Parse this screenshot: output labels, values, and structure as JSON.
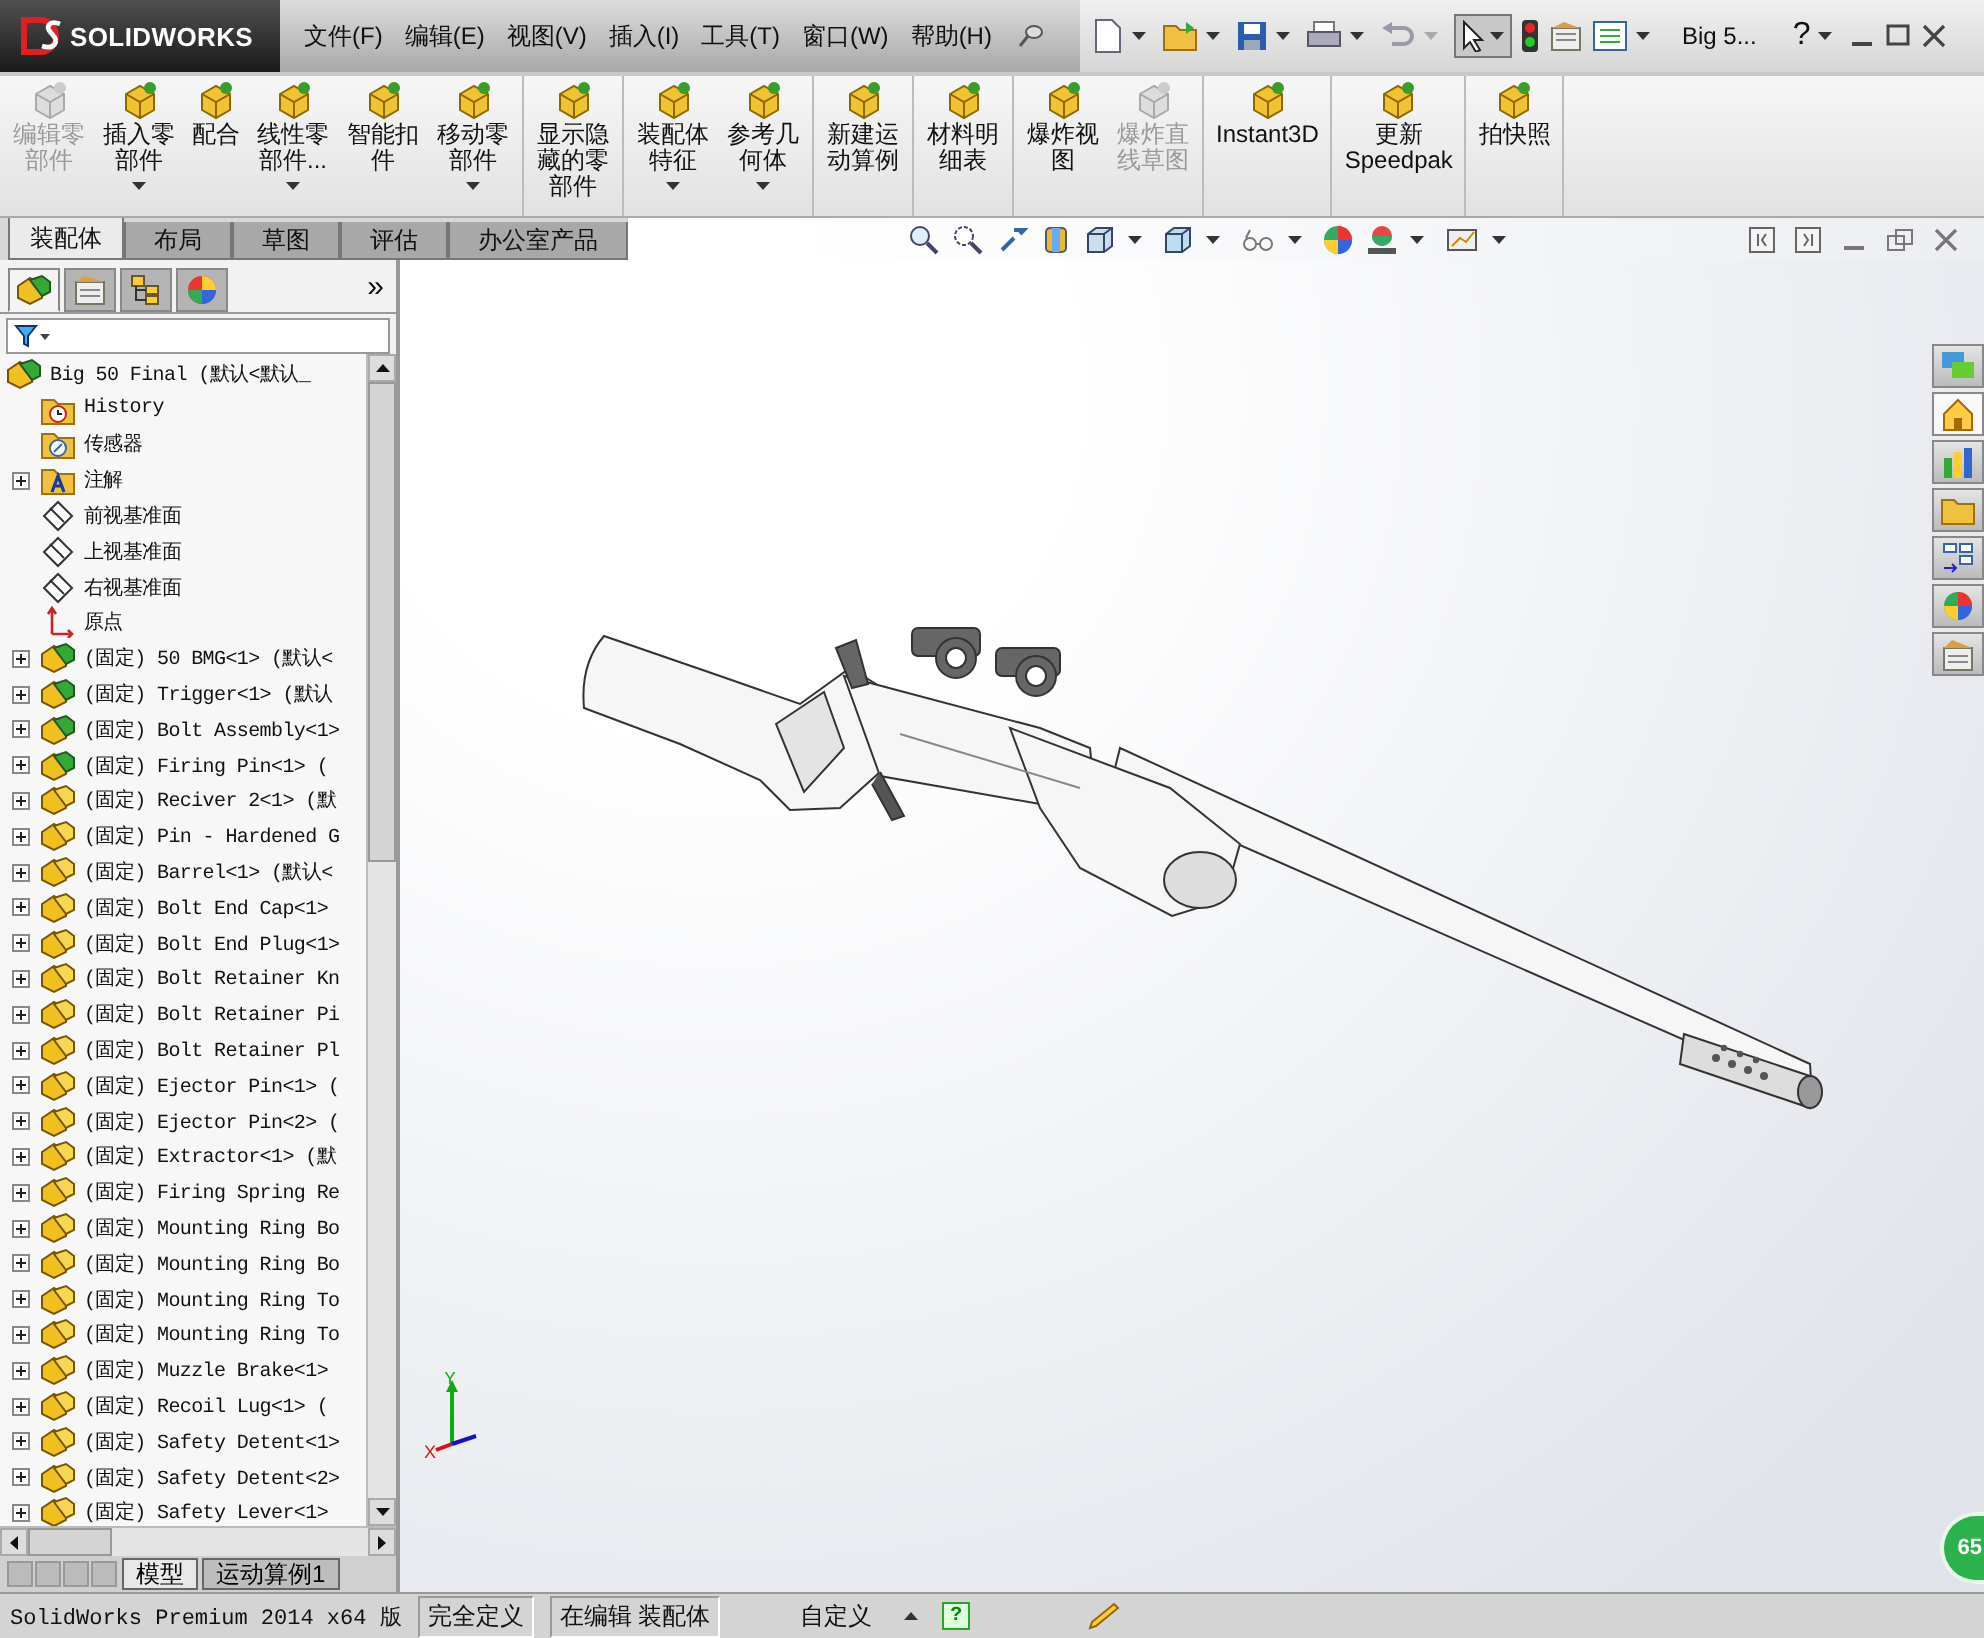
{
  "title_bar": {
    "logo": "SOLIDWORKS",
    "menus": [
      "文件(F)",
      "编辑(E)",
      "视图(V)",
      "插入(I)",
      "工具(T)",
      "窗口(W)",
      "帮助(H)"
    ],
    "document": "Big 5...",
    "help": "?"
  },
  "ribbon": {
    "groups": [
      {
        "buttons": [
          {
            "label": "编辑零部件",
            "disabled": true,
            "dropdown": false
          },
          {
            "label": "插入零部件",
            "disabled": false,
            "dropdown": true
          },
          {
            "label": "配合",
            "disabled": false,
            "dropdown": false
          },
          {
            "label": "线性零部件...",
            "disabled": false,
            "dropdown": true
          },
          {
            "label": "智能扣件",
            "disabled": false,
            "dropdown": false
          },
          {
            "label": "移动零部件",
            "disabled": false,
            "dropdown": true
          }
        ]
      },
      {
        "buttons": [
          {
            "label": "显示隐藏的零部件",
            "disabled": false,
            "dropdown": false
          }
        ]
      },
      {
        "buttons": [
          {
            "label": "装配体特征",
            "disabled": false,
            "dropdown": true
          },
          {
            "label": "参考几何体",
            "disabled": false,
            "dropdown": true
          }
        ]
      },
      {
        "buttons": [
          {
            "label": "新建运动算例",
            "disabled": false,
            "dropdown": false
          }
        ]
      },
      {
        "buttons": [
          {
            "label": "材料明细表",
            "disabled": false,
            "dropdown": false
          }
        ]
      },
      {
        "buttons": [
          {
            "label": "爆炸视图",
            "disabled": false,
            "dropdown": false
          },
          {
            "label": "爆炸直线草图",
            "disabled": true,
            "dropdown": false
          }
        ]
      },
      {
        "buttons": [
          {
            "label": "Instant3D",
            "disabled": false,
            "dropdown": false
          }
        ]
      },
      {
        "buttons": [
          {
            "label": "更新Speedpak",
            "disabled": false,
            "dropdown": false
          }
        ]
      },
      {
        "buttons": [
          {
            "label": "拍快照",
            "disabled": false,
            "dropdown": false
          }
        ]
      }
    ]
  },
  "command_tabs": [
    {
      "label": "装配体",
      "selected": true
    },
    {
      "label": "布局",
      "selected": false
    },
    {
      "label": "草图",
      "selected": false
    },
    {
      "label": "评估",
      "selected": false
    },
    {
      "label": "办公室产品",
      "selected": false
    }
  ],
  "panel": {
    "tabs": [
      {
        "kind": "tree",
        "selected": true
      },
      {
        "kind": "properties",
        "selected": false
      },
      {
        "kind": "configurations",
        "selected": false
      },
      {
        "kind": "display",
        "selected": false
      }
    ],
    "more": "»",
    "tree": {
      "label": "Big 50 Final  (默认<默认_",
      "kind": "assembly",
      "children": [
        {
          "label": "History",
          "kind": "history"
        },
        {
          "label": "传感器",
          "kind": "sensor"
        },
        {
          "label": "注解",
          "kind": "annotation",
          "expanded": false
        },
        {
          "label": "前视基准面",
          "kind": "plane"
        },
        {
          "label": "上视基准面",
          "kind": "plane"
        },
        {
          "label": "右视基准面",
          "kind": "plane"
        },
        {
          "label": "原点",
          "kind": "origin"
        },
        {
          "label": "(固定) 50 BMG<1> (默认<",
          "kind": "assembly",
          "expanded": false
        },
        {
          "label": "(固定) Trigger<1> (默认",
          "kind": "assembly",
          "expanded": false
        },
        {
          "label": "(固定) Bolt Assembly<1>",
          "kind": "assembly",
          "expanded": false
        },
        {
          "label": "(固定) Firing Pin<1> (",
          "kind": "assembly",
          "expanded": false
        },
        {
          "label": "(固定) Reciver 2<1> (默",
          "kind": "part",
          "expanded": false
        },
        {
          "label": "(固定) Pin - Hardened G",
          "kind": "part",
          "expanded": false
        },
        {
          "label": "(固定) Barrel<1> (默认<",
          "kind": "part",
          "expanded": false
        },
        {
          "label": "(固定) Bolt End Cap<1>",
          "kind": "part",
          "expanded": false
        },
        {
          "label": "(固定) Bolt End Plug<1>",
          "kind": "part",
          "expanded": false
        },
        {
          "label": "(固定) Bolt Retainer Kn",
          "kind": "part",
          "expanded": false
        },
        {
          "label": "(固定) Bolt Retainer Pi",
          "kind": "part",
          "expanded": false
        },
        {
          "label": "(固定) Bolt Retainer Pl",
          "kind": "part",
          "expanded": false
        },
        {
          "label": "(固定) Ejector Pin<1> (",
          "kind": "part",
          "expanded": false
        },
        {
          "label": "(固定) Ejector Pin<2> (",
          "kind": "part",
          "expanded": false
        },
        {
          "label": "(固定) Extractor<1> (默",
          "kind": "part",
          "expanded": false
        },
        {
          "label": "(固定) Firing Spring Re",
          "kind": "part",
          "expanded": false
        },
        {
          "label": "(固定) Mounting Ring Bo",
          "kind": "part",
          "expanded": false
        },
        {
          "label": "(固定) Mounting Ring Bo",
          "kind": "part",
          "expanded": false
        },
        {
          "label": "(固定) Mounting Ring To",
          "kind": "part",
          "expanded": false
        },
        {
          "label": "(固定) Mounting Ring To",
          "kind": "part",
          "expanded": false
        },
        {
          "label": "(固定) Muzzle Brake<1>",
          "kind": "part",
          "expanded": false
        },
        {
          "label": "(固定) Recoil Lug<1> (",
          "kind": "part",
          "expanded": false
        },
        {
          "label": "(固定) Safety Detent<1>",
          "kind": "part",
          "expanded": false
        },
        {
          "label": "(固定) Safety Detent<2>",
          "kind": "part",
          "expanded": false
        },
        {
          "label": "(固定) Safety Lever<1>",
          "kind": "part",
          "expanded": false
        }
      ]
    },
    "bottom_tabs": [
      {
        "label": "模型",
        "selected": true
      },
      {
        "label": "运动算例1",
        "selected": false
      }
    ]
  },
  "viewport": {
    "triad_labels": [
      "Y",
      "X"
    ],
    "corner_badge": "65"
  },
  "status_bar": {
    "product": "SolidWorks Premium 2014 x64 版",
    "segments": [
      "完全定义",
      "在编辑 装配体"
    ],
    "units": "自定义",
    "help": "?"
  }
}
